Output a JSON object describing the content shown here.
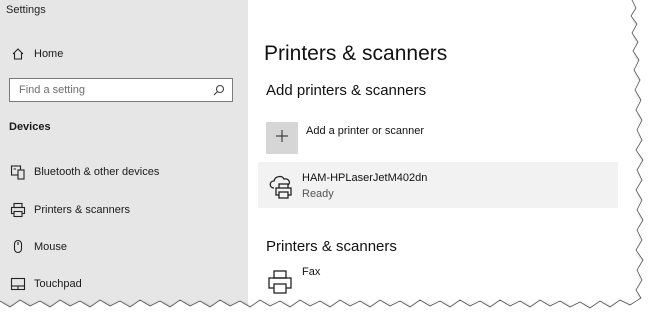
{
  "window": {
    "title": "Settings"
  },
  "sidebar": {
    "home_label": "Home",
    "search_placeholder": "Find a setting",
    "section_title": "Devices",
    "items": [
      {
        "label": "Bluetooth & other devices",
        "icon": "bluetooth-device-icon"
      },
      {
        "label": "Printers & scanners",
        "icon": "printer-icon"
      },
      {
        "label": "Mouse",
        "icon": "mouse-icon"
      },
      {
        "label": "Touchpad",
        "icon": "touchpad-icon"
      }
    ]
  },
  "main": {
    "title": "Printers & scanners",
    "add_section_title": "Add printers & scanners",
    "add_button_label": "Add a printer or scanner",
    "devices": [
      {
        "name": "HAM-HPLaserJetM402dn",
        "status": "Ready"
      }
    ],
    "printers_section_title": "Printers & scanners",
    "printers": [
      {
        "name": "Fax"
      }
    ]
  },
  "colors": {
    "sidebar_bg": "#e6e6e6",
    "card_bg": "#f2f2f2",
    "add_button_bg": "#d6d6d6"
  }
}
